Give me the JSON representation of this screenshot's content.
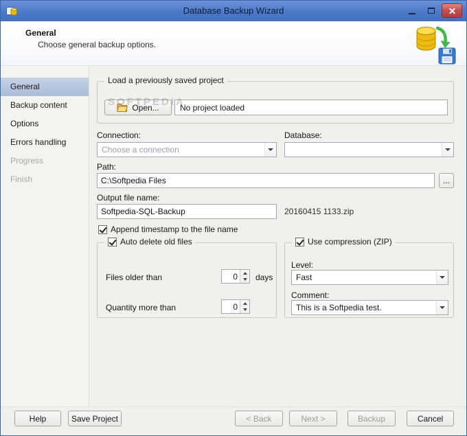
{
  "window": {
    "title": "Database Backup Wizard"
  },
  "header": {
    "title": "General",
    "subtitle": "Choose general backup options."
  },
  "sidebar": {
    "items": [
      {
        "label": "General",
        "state": "selected"
      },
      {
        "label": "Backup content",
        "state": "enabled"
      },
      {
        "label": "Options",
        "state": "enabled"
      },
      {
        "label": "Errors handling",
        "state": "enabled"
      },
      {
        "label": "Progress",
        "state": "disabled"
      },
      {
        "label": "Finish",
        "state": "disabled"
      }
    ]
  },
  "main": {
    "load_group": {
      "title": "Load a previously saved project",
      "open_label": "Open...",
      "status": "No project loaded",
      "watermark": "SOFTPEDIA"
    },
    "connection": {
      "label": "Connection:",
      "value": "Choose a connection"
    },
    "database": {
      "label": "Database:",
      "value": ""
    },
    "path": {
      "label": "Path:",
      "value": "C:\\Softpedia Files",
      "browse": "..."
    },
    "output": {
      "label": "Output file name:",
      "value": "Softpedia-SQL-Backup",
      "preview": "20160415 1133.zip"
    },
    "append_timestamp": {
      "label": "Append timestamp to the file name",
      "checked": true
    },
    "auto_delete": {
      "title": "Auto delete old files",
      "checked": true,
      "older_label": "Files older than",
      "older_value": "0",
      "older_suffix": "days",
      "qty_label": "Quantity more than",
      "qty_value": "0"
    },
    "compression": {
      "title": "Use compression (ZIP)",
      "checked": true,
      "level_label": "Level:",
      "level_value": "Fast",
      "comment_label": "Comment:",
      "comment_value": "This is a Softpedia test."
    }
  },
  "footer": {
    "help": "Help",
    "save_project": "Save Project",
    "back": "< Back",
    "next": "Next >",
    "backup": "Backup",
    "cancel": "Cancel"
  },
  "colors": {
    "titlebar_blue": "#4d79c6",
    "close_red": "#c75050",
    "selection_blue": "#aabcd8",
    "icon_yellow": "#f0c020",
    "icon_green": "#41b649",
    "icon_blue": "#3a79d0"
  }
}
